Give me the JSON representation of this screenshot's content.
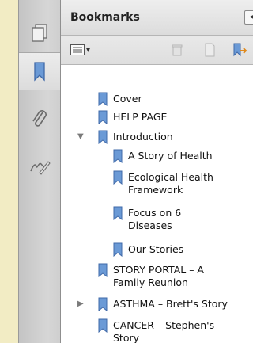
{
  "panel": {
    "title": "Bookmarks",
    "collapse_label": "◂"
  },
  "rail": {
    "items": [
      {
        "name": "pages",
        "icon": "pages-icon"
      },
      {
        "name": "bookmarks",
        "icon": "bookmark-icon",
        "selected": true
      },
      {
        "name": "attachments",
        "icon": "paperclip-icon"
      },
      {
        "name": "signatures",
        "icon": "signature-icon"
      }
    ]
  },
  "toolbar": {
    "options_caret": "▾"
  },
  "bookmarks": [
    {
      "label_lines": [
        "Cover"
      ],
      "level": 0,
      "twisty": ""
    },
    {
      "label_lines": [
        "HELP PAGE"
      ],
      "level": 0,
      "twisty": ""
    },
    {
      "label_lines": [
        "Introduction"
      ],
      "level": 0,
      "twisty": "▼"
    },
    {
      "label_lines": [
        "A Story of Health"
      ],
      "level": 1,
      "twisty": ""
    },
    {
      "label_lines": [
        "Ecological Health",
        "Framework"
      ],
      "level": 1,
      "twisty": ""
    },
    {
      "label_lines": [
        "Focus on 6",
        "Diseases"
      ],
      "level": 1,
      "twisty": ""
    },
    {
      "label_lines": [
        "Our Stories"
      ],
      "level": 1,
      "twisty": ""
    },
    {
      "label_lines": [
        "STORY PORTAL – A",
        "Family Reunion"
      ],
      "level": 0,
      "twisty": ""
    },
    {
      "label_lines": [
        "ASTHMA – Brett's Story"
      ],
      "level": 0,
      "twisty": "▶"
    },
    {
      "label_lines": [
        "CANCER – Stephen's",
        "Story"
      ],
      "level": 0,
      "twisty": ""
    }
  ],
  "colors": {
    "bookmark_fill": "#6b9ad6",
    "bookmark_stroke": "#3f69a8",
    "page_background": "#f2ecc4"
  }
}
